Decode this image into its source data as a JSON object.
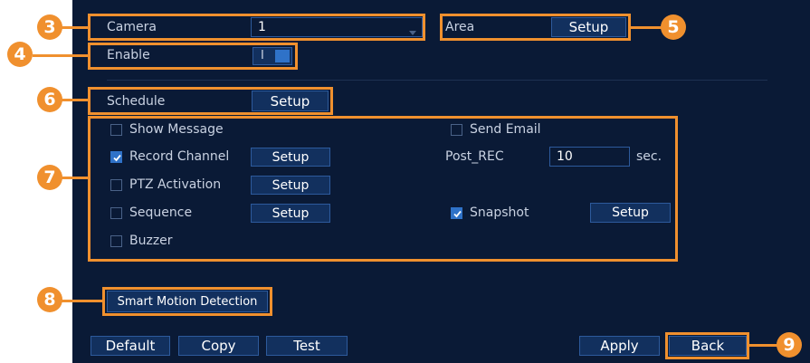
{
  "motion": {
    "camera_label": "Camera",
    "camera_value": "1",
    "area_label": "Area",
    "area_setup": "Setup",
    "enable_label": "Enable",
    "enable_toggle_text": "I",
    "schedule_label": "Schedule",
    "schedule_setup": "Setup"
  },
  "actions": {
    "show_message": {
      "label": "Show Message",
      "checked": false
    },
    "send_email": {
      "label": "Send Email",
      "checked": false
    },
    "record_channel": {
      "label": "Record Channel",
      "checked": true,
      "setup": "Setup"
    },
    "post_rec": {
      "label": "Post_REC",
      "value": "10",
      "unit": "sec."
    },
    "ptz_activation": {
      "label": "PTZ Activation",
      "checked": false,
      "setup": "Setup"
    },
    "sequence": {
      "label": "Sequence",
      "checked": false,
      "setup": "Setup"
    },
    "snapshot": {
      "label": "Snapshot",
      "checked": true,
      "setup": "Setup"
    },
    "buzzer": {
      "label": "Buzzer",
      "checked": false
    }
  },
  "smart_motion_detection": "Smart Motion Detection",
  "footer": {
    "default": "Default",
    "copy": "Copy",
    "test": "Test",
    "apply": "Apply",
    "back": "Back"
  },
  "callouts": [
    "3",
    "4",
    "5",
    "6",
    "7",
    "8",
    "9"
  ],
  "colors": {
    "background": "#0a1a36",
    "button": "#12305e",
    "button_border": "#2d5a9c",
    "highlight": "#f0902e",
    "checkbox_checked": "#2f72c8",
    "text": "#c9d2e2"
  }
}
